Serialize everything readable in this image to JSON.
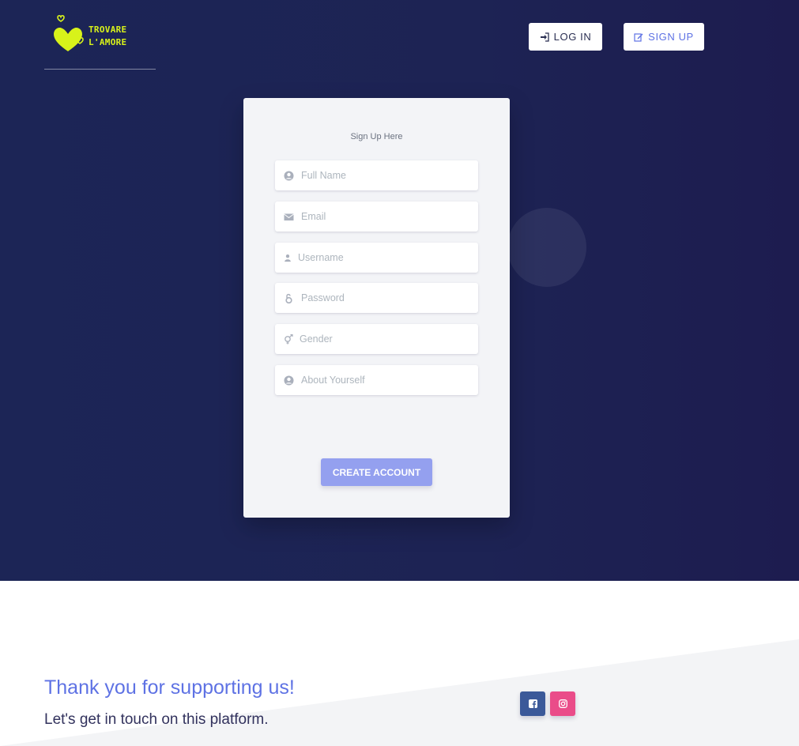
{
  "brand": {
    "line1": "TROVARE",
    "line2": "L'AMORE",
    "color": "#d8f21a"
  },
  "nav": {
    "login_label": "LOG IN",
    "signup_label": "SIGN UP"
  },
  "form": {
    "title": "Sign Up Here",
    "fields": [
      {
        "placeholder": "Full Name",
        "icon": "user-circle-icon"
      },
      {
        "placeholder": "Email",
        "icon": "envelope-icon"
      },
      {
        "placeholder": "Username",
        "icon": "user-icon"
      },
      {
        "placeholder": "Password",
        "icon": "unlock-icon"
      },
      {
        "placeholder": "Gender",
        "icon": "gender-icon"
      },
      {
        "placeholder": "About Yourself",
        "icon": "user-circle-icon"
      }
    ],
    "submit_label": "CREATE ACCOUNT"
  },
  "footer": {
    "heading": "Thank you for supporting us!",
    "subheading": "Let's get in touch on this platform.",
    "social": [
      {
        "icon": "facebook-icon",
        "color": "#3b5999"
      },
      {
        "icon": "instagram-icon",
        "color": "#ea4c89"
      }
    ]
  },
  "colors": {
    "hero_bg": "#1c2556",
    "accent": "#5e72e4",
    "button": "#94a0ef"
  }
}
